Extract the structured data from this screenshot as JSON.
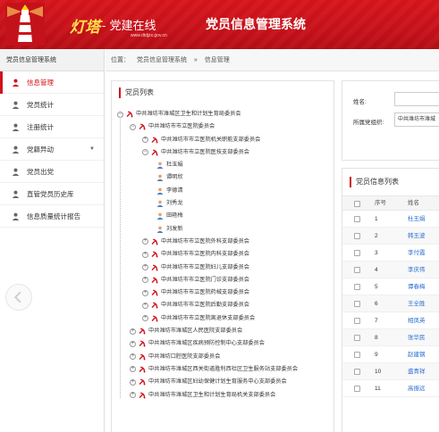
{
  "header": {
    "brand_main": "灯塔",
    "brand_sub": "- 党建在线",
    "brand_url": "www.dtdjzx.gov.cn",
    "app_title": "党员信息管理系统"
  },
  "sidebar": {
    "title": "党员信息管理系统",
    "items": [
      {
        "label": "信息管理",
        "active": true
      },
      {
        "label": "党员统计"
      },
      {
        "label": "注册统计"
      },
      {
        "label": "党籍异动",
        "has_dropdown": true
      },
      {
        "label": "党员出党"
      },
      {
        "label": "直管党员历史库"
      },
      {
        "label": "信息质量统计报告"
      }
    ]
  },
  "breadcrumb": {
    "prefix": "位置：",
    "crumbs": [
      "党员信息管理系统",
      "»",
      "信息管理"
    ]
  },
  "tree_panel": {
    "title": "党员列表",
    "nodes": [
      {
        "label": "中共潍坊市潍城区卫生和计划生育局委员会",
        "level": 0,
        "type": "org",
        "state": "open"
      },
      {
        "label": "中共潍坊市市立医院委员会",
        "level": 1,
        "type": "org",
        "state": "open"
      },
      {
        "label": "中共潍坊市市立医院机关职能支部委员会",
        "level": 2,
        "type": "org",
        "state": "closed"
      },
      {
        "label": "中共潍坊市市立医院医技支部委员会",
        "level": 2,
        "type": "org",
        "state": "open"
      },
      {
        "label": "杜玉娟",
        "level": 3,
        "type": "person"
      },
      {
        "label": "谭明欣",
        "level": 3,
        "type": "person"
      },
      {
        "label": "李德清",
        "level": 3,
        "type": "person"
      },
      {
        "label": "刘秀龙",
        "level": 3,
        "type": "person"
      },
      {
        "label": "田艳梅",
        "level": 3,
        "type": "person"
      },
      {
        "label": "刘发新",
        "level": 3,
        "type": "person"
      },
      {
        "label": "中共潍坊市市立医院外科支部委员会",
        "level": 2,
        "type": "org",
        "state": "closed"
      },
      {
        "label": "中共潍坊市市立医院内科支部委员会",
        "level": 2,
        "type": "org",
        "state": "closed"
      },
      {
        "label": "中共潍坊市市立医院妇儿支部委员会",
        "level": 2,
        "type": "org",
        "state": "closed"
      },
      {
        "label": "中共潍坊市市立医院门诊支部委员会",
        "level": 2,
        "type": "org",
        "state": "closed"
      },
      {
        "label": "中共潍坊市市立医院药械支部委员会",
        "level": 2,
        "type": "org",
        "state": "closed"
      },
      {
        "label": "中共潍坊市市立医院后勤支部委员会",
        "level": 2,
        "type": "org",
        "state": "closed"
      },
      {
        "label": "中共潍坊市市立医院离退休支部委员会",
        "level": 2,
        "type": "org",
        "state": "closed"
      },
      {
        "label": "中共潍坊市潍城区人民医院支部委员会",
        "level": 1,
        "type": "org",
        "state": "closed"
      },
      {
        "label": "中共潍坊市潍城区疾病预防控制中心支部委员会",
        "level": 1,
        "type": "org",
        "state": "closed"
      },
      {
        "label": "中共潍坊口腔医院支部委员会",
        "level": 1,
        "type": "org",
        "state": "closed"
      },
      {
        "label": "中共潍坊市潍城区西关街道胜利西社区卫生服务站支部委员会",
        "level": 1,
        "type": "org",
        "state": "closed"
      },
      {
        "label": "中共潍坊市潍城区妇幼保健计划生育服务中心支部委员会",
        "level": 1,
        "type": "org",
        "state": "closed"
      },
      {
        "label": "中共潍坊市潍城区卫生和计划生育局机关支部委员会",
        "level": 1,
        "type": "org",
        "state": "closed"
      }
    ]
  },
  "filter": {
    "name_label": "姓名:",
    "name_value": "",
    "org_label": "所属党组织:",
    "org_value": "中共潍坊市潍城"
  },
  "member_list": {
    "title": "党员信息列表",
    "col_seq": "序号",
    "col_name": "姓名",
    "rows": [
      {
        "num": "1",
        "name": "杜玉娟"
      },
      {
        "num": "2",
        "name": "韩玉波"
      },
      {
        "num": "3",
        "name": "李付霞"
      },
      {
        "num": "4",
        "name": "李庆伟"
      },
      {
        "num": "5",
        "name": "谭春梅"
      },
      {
        "num": "6",
        "name": "王全胜"
      },
      {
        "num": "7",
        "name": "相凤英"
      },
      {
        "num": "8",
        "name": "张华民"
      },
      {
        "num": "9",
        "name": "赵建钢"
      },
      {
        "num": "10",
        "name": "盛青祥"
      },
      {
        "num": "11",
        "name": "高振远"
      }
    ]
  },
  "colors": {
    "brand_red": "#d0121b",
    "link_blue": "#2a6fd1",
    "accent_yellow": "#ffe14d"
  }
}
